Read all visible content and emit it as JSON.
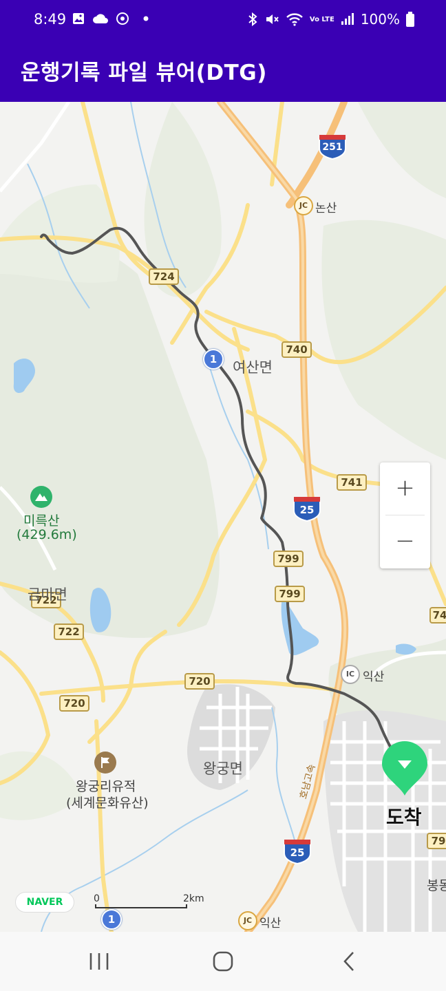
{
  "status_bar": {
    "time": "8:49",
    "battery": "100%",
    "network": "Vo LTE",
    "icons": [
      "image-icon",
      "cloud-icon",
      "location-target-icon",
      "dot-icon",
      "bluetooth-icon",
      "mute-icon",
      "wifi-icon",
      "signal-icon",
      "battery-icon"
    ]
  },
  "app_bar": {
    "title": "운행기록 파일 뷰어(DTG)"
  },
  "map": {
    "places": {
      "nonsan": "논산",
      "yeosan": "여산면",
      "mireuksan": "미륵산",
      "mireuksan_height": "(429.6m)",
      "geumma": "금마면",
      "wanggung": "왕궁면",
      "wanggungri": "왕궁리유적",
      "world_heritage": "(세계문화유산)",
      "iksan_ic": "익산",
      "iksan_jc": "익산",
      "honam_expressway": "호남고속",
      "bong": "봉동"
    },
    "roads": {
      "r724": "724",
      "r740": "740",
      "r741": "741",
      "r799a": "799",
      "r799b": "799",
      "r722a": "722",
      "r722b": "722",
      "r720a": "720",
      "r720b": "720",
      "r74x": "74",
      "r79x": "79",
      "hwy251": "251",
      "hwy25a": "25",
      "hwy25b": "25",
      "nat1a": "1",
      "nat1b": "1",
      "jc": "JC",
      "ic": "IC"
    },
    "arrive_label": "도착",
    "zoom_in": "+",
    "zoom_out": "−",
    "naver": "NAVER",
    "scale_start": "0",
    "scale_end": "2km",
    "colors": {
      "route": "#555555",
      "pin": "#2ed47c",
      "highway": "#f5c57b",
      "road": "#fbe28c"
    }
  },
  "nav_bar": {
    "buttons": [
      "recent-apps-icon",
      "home-icon",
      "back-icon"
    ]
  }
}
